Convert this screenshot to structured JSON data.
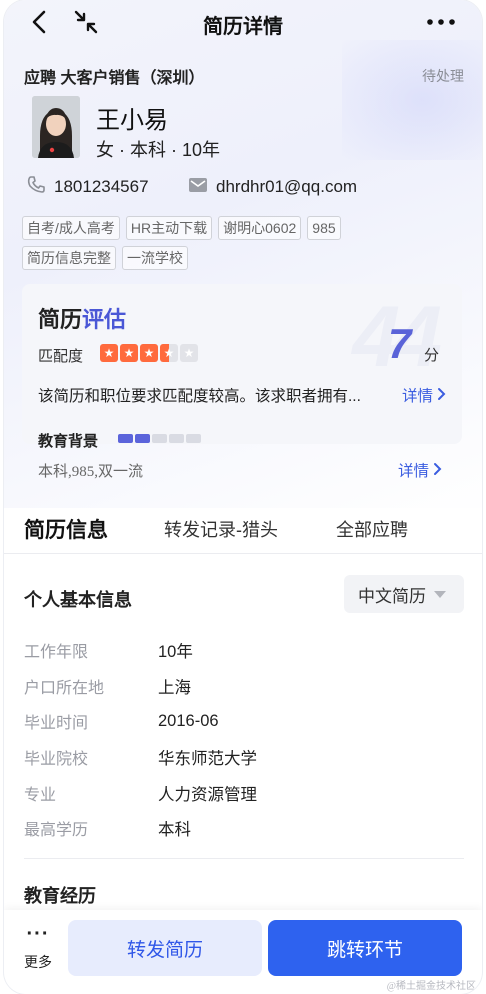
{
  "nav": {
    "title": "简历详情"
  },
  "header": {
    "apply_title": "应聘 大客户销售（深圳）",
    "status": "待处理",
    "name": "王小易",
    "meta": "女 · 本科 · 10年",
    "phone": "1801234567",
    "email": "dhrdhr01@qq.com"
  },
  "tags": [
    "自考/成人高考",
    "HR主动下载",
    "谢明心0602",
    "985",
    "简历信息完整",
    "一流学校"
  ],
  "evaluation": {
    "title_plain": "简历",
    "title_accent": "评估",
    "match_label": "匹配度",
    "match_stars": 3.5,
    "match_max": 5,
    "score": "7",
    "score_unit": "分",
    "summary": "该简历和职位要求匹配度较高。该求职者拥有...",
    "detail_label": "详情",
    "education_label": "教育背景",
    "education_level": 2,
    "education_max": 5,
    "education_text": "本科,985,双一流",
    "education_detail_label": "详情"
  },
  "tabs": [
    {
      "label": "简历信息",
      "active": true
    },
    {
      "label": "转发记录-猎头",
      "active": false
    },
    {
      "label": "全部应聘",
      "active": false
    }
  ],
  "basic_info": {
    "title": "个人基本信息",
    "lang_select": "中文简历",
    "rows": [
      {
        "key": "工作年限",
        "value": "10年"
      },
      {
        "key": "户口所在地",
        "value": "上海"
      },
      {
        "key": "毕业时间",
        "value": "2016-06"
      },
      {
        "key": "毕业院校",
        "value": "华东师范大学"
      },
      {
        "key": "专业",
        "value": "人力资源管理"
      },
      {
        "key": "最高学历",
        "value": "本科"
      }
    ]
  },
  "education_section": {
    "title": "教育经历"
  },
  "bottom_bar": {
    "more_label": "更多",
    "forward_label": "转发简历",
    "jump_label": "跳转环节"
  },
  "watermark": "@稀土掘金技术社区",
  "colors": {
    "accent": "#2e62ef",
    "star": "#ff6a3d",
    "score": "#5a63d8"
  }
}
